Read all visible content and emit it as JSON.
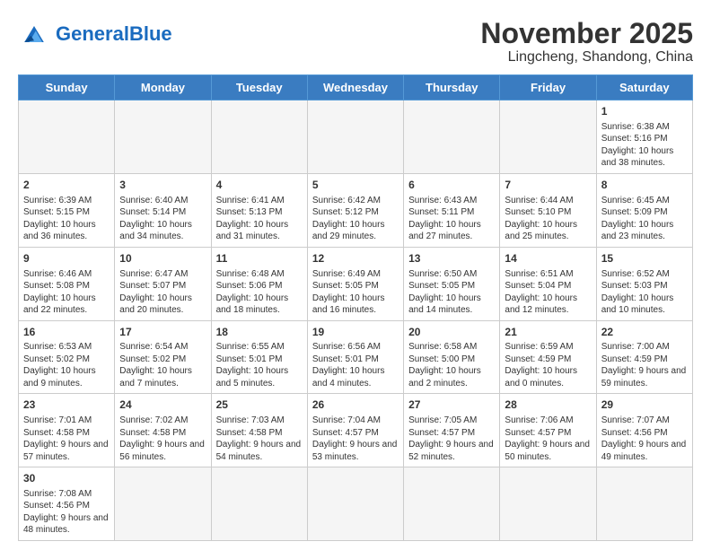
{
  "logo": {
    "general": "General",
    "blue": "Blue"
  },
  "title": "November 2025",
  "subtitle": "Lingcheng, Shandong, China",
  "weekdays": [
    "Sunday",
    "Monday",
    "Tuesday",
    "Wednesday",
    "Thursday",
    "Friday",
    "Saturday"
  ],
  "weeks": [
    [
      {
        "num": "",
        "info": "",
        "empty": true
      },
      {
        "num": "",
        "info": "",
        "empty": true
      },
      {
        "num": "",
        "info": "",
        "empty": true
      },
      {
        "num": "",
        "info": "",
        "empty": true
      },
      {
        "num": "",
        "info": "",
        "empty": true
      },
      {
        "num": "",
        "info": "",
        "empty": true
      },
      {
        "num": "1",
        "info": "Sunrise: 6:38 AM\nSunset: 5:16 PM\nDaylight: 10 hours\nand 38 minutes."
      }
    ],
    [
      {
        "num": "2",
        "info": "Sunrise: 6:39 AM\nSunset: 5:15 PM\nDaylight: 10 hours\nand 36 minutes."
      },
      {
        "num": "3",
        "info": "Sunrise: 6:40 AM\nSunset: 5:14 PM\nDaylight: 10 hours\nand 34 minutes."
      },
      {
        "num": "4",
        "info": "Sunrise: 6:41 AM\nSunset: 5:13 PM\nDaylight: 10 hours\nand 31 minutes."
      },
      {
        "num": "5",
        "info": "Sunrise: 6:42 AM\nSunset: 5:12 PM\nDaylight: 10 hours\nand 29 minutes."
      },
      {
        "num": "6",
        "info": "Sunrise: 6:43 AM\nSunset: 5:11 PM\nDaylight: 10 hours\nand 27 minutes."
      },
      {
        "num": "7",
        "info": "Sunrise: 6:44 AM\nSunset: 5:10 PM\nDaylight: 10 hours\nand 25 minutes."
      },
      {
        "num": "8",
        "info": "Sunrise: 6:45 AM\nSunset: 5:09 PM\nDaylight: 10 hours\nand 23 minutes."
      }
    ],
    [
      {
        "num": "9",
        "info": "Sunrise: 6:46 AM\nSunset: 5:08 PM\nDaylight: 10 hours\nand 22 minutes."
      },
      {
        "num": "10",
        "info": "Sunrise: 6:47 AM\nSunset: 5:07 PM\nDaylight: 10 hours\nand 20 minutes."
      },
      {
        "num": "11",
        "info": "Sunrise: 6:48 AM\nSunset: 5:06 PM\nDaylight: 10 hours\nand 18 minutes."
      },
      {
        "num": "12",
        "info": "Sunrise: 6:49 AM\nSunset: 5:05 PM\nDaylight: 10 hours\nand 16 minutes."
      },
      {
        "num": "13",
        "info": "Sunrise: 6:50 AM\nSunset: 5:05 PM\nDaylight: 10 hours\nand 14 minutes."
      },
      {
        "num": "14",
        "info": "Sunrise: 6:51 AM\nSunset: 5:04 PM\nDaylight: 10 hours\nand 12 minutes."
      },
      {
        "num": "15",
        "info": "Sunrise: 6:52 AM\nSunset: 5:03 PM\nDaylight: 10 hours\nand 10 minutes."
      }
    ],
    [
      {
        "num": "16",
        "info": "Sunrise: 6:53 AM\nSunset: 5:02 PM\nDaylight: 10 hours\nand 9 minutes."
      },
      {
        "num": "17",
        "info": "Sunrise: 6:54 AM\nSunset: 5:02 PM\nDaylight: 10 hours\nand 7 minutes."
      },
      {
        "num": "18",
        "info": "Sunrise: 6:55 AM\nSunset: 5:01 PM\nDaylight: 10 hours\nand 5 minutes."
      },
      {
        "num": "19",
        "info": "Sunrise: 6:56 AM\nSunset: 5:01 PM\nDaylight: 10 hours\nand 4 minutes."
      },
      {
        "num": "20",
        "info": "Sunrise: 6:58 AM\nSunset: 5:00 PM\nDaylight: 10 hours\nand 2 minutes."
      },
      {
        "num": "21",
        "info": "Sunrise: 6:59 AM\nSunset: 4:59 PM\nDaylight: 10 hours\nand 0 minutes."
      },
      {
        "num": "22",
        "info": "Sunrise: 7:00 AM\nSunset: 4:59 PM\nDaylight: 9 hours\nand 59 minutes."
      }
    ],
    [
      {
        "num": "23",
        "info": "Sunrise: 7:01 AM\nSunset: 4:58 PM\nDaylight: 9 hours\nand 57 minutes."
      },
      {
        "num": "24",
        "info": "Sunrise: 7:02 AM\nSunset: 4:58 PM\nDaylight: 9 hours\nand 56 minutes."
      },
      {
        "num": "25",
        "info": "Sunrise: 7:03 AM\nSunset: 4:58 PM\nDaylight: 9 hours\nand 54 minutes."
      },
      {
        "num": "26",
        "info": "Sunrise: 7:04 AM\nSunset: 4:57 PM\nDaylight: 9 hours\nand 53 minutes."
      },
      {
        "num": "27",
        "info": "Sunrise: 7:05 AM\nSunset: 4:57 PM\nDaylight: 9 hours\nand 52 minutes."
      },
      {
        "num": "28",
        "info": "Sunrise: 7:06 AM\nSunset: 4:57 PM\nDaylight: 9 hours\nand 50 minutes."
      },
      {
        "num": "29",
        "info": "Sunrise: 7:07 AM\nSunset: 4:56 PM\nDaylight: 9 hours\nand 49 minutes."
      }
    ],
    [
      {
        "num": "30",
        "info": "Sunrise: 7:08 AM\nSunset: 4:56 PM\nDaylight: 9 hours\nand 48 minutes."
      },
      {
        "num": "",
        "info": "",
        "empty": true
      },
      {
        "num": "",
        "info": "",
        "empty": true
      },
      {
        "num": "",
        "info": "",
        "empty": true
      },
      {
        "num": "",
        "info": "",
        "empty": true
      },
      {
        "num": "",
        "info": "",
        "empty": true
      },
      {
        "num": "",
        "info": "",
        "empty": true
      }
    ]
  ]
}
